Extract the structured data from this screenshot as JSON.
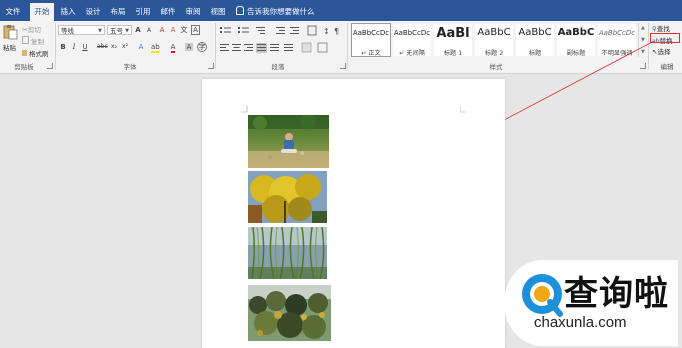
{
  "tabs": [
    {
      "label": "文件",
      "active": false
    },
    {
      "label": "开始",
      "active": true
    },
    {
      "label": "插入",
      "active": false
    },
    {
      "label": "设计",
      "active": false
    },
    {
      "label": "布局",
      "active": false
    },
    {
      "label": "引用",
      "active": false
    },
    {
      "label": "邮件",
      "active": false
    },
    {
      "label": "审阅",
      "active": false
    },
    {
      "label": "视图",
      "active": false
    }
  ],
  "tell_me": "告诉我你想要做什么",
  "clipboard": {
    "paste": "粘贴",
    "cut": "剪切",
    "copy": "复制",
    "format_painter": "格式刷",
    "group_label": "剪贴板"
  },
  "font": {
    "family": "等线",
    "size": "五号",
    "group_label": "字体"
  },
  "paragraph": {
    "group_label": "段落"
  },
  "styles": {
    "group_label": "样式",
    "items": [
      {
        "preview": "AaBbCcDc",
        "name": "↵ 正文"
      },
      {
        "preview": "AaBbCcDc",
        "name": "↵ 无间隔"
      },
      {
        "preview": "AaBl",
        "name": "标题 1"
      },
      {
        "preview": "AaBbC",
        "name": "标题 2"
      },
      {
        "preview": "AaBbC",
        "name": "标题"
      },
      {
        "preview": "AaBbC",
        "name": "副标题"
      },
      {
        "preview": "AaBbCcDc",
        "name": "不明显强调"
      }
    ]
  },
  "editing": {
    "find": "查找",
    "replace": "替换",
    "select": "选择",
    "group_label": "编辑"
  },
  "watermark": {
    "logo_text": "查询啦",
    "domain": "chaxunla.com"
  },
  "colors": {
    "accent": "#2b579a",
    "annotation": "#e03030",
    "watermark_blue": "#1e8fd9"
  }
}
